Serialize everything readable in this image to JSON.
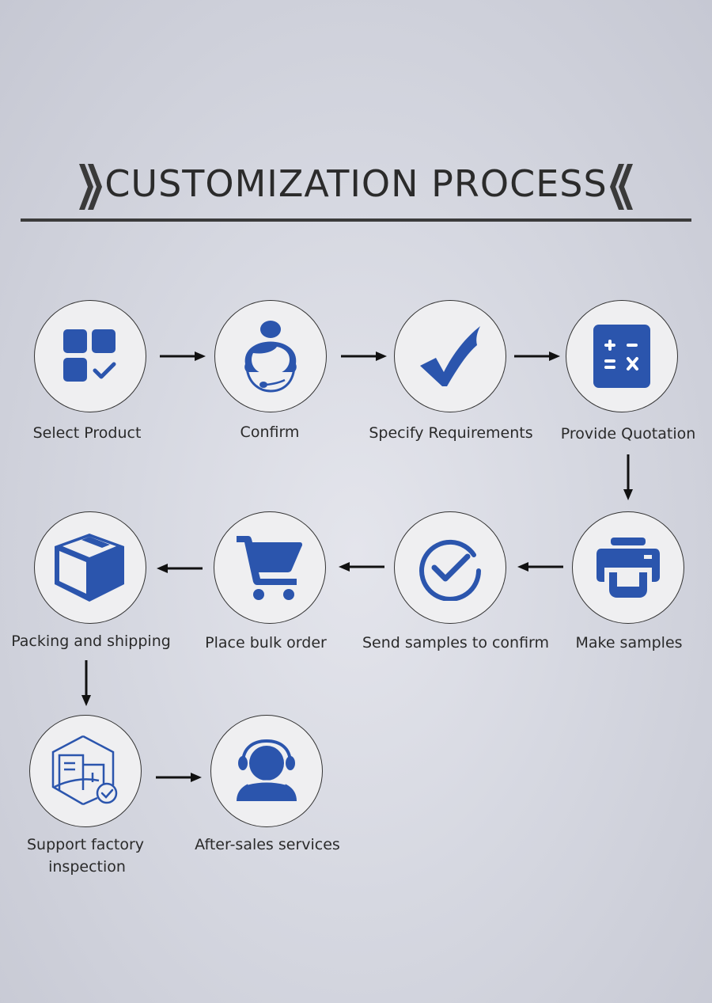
{
  "header": {
    "title": "CUSTOMIZATION PROCESS",
    "left_decoration": "double-chevron-right-icon",
    "right_decoration": "double-chevron-left-icon"
  },
  "colors": {
    "icon_blue": "#2b55ad",
    "text": "#2a2a2a",
    "arrow": "#111111",
    "circle_fill": "#efeff1"
  },
  "steps": [
    {
      "label": "Select Product",
      "icon": "grid-check-icon"
    },
    {
      "label": "Confirm",
      "icon": "headset-agent-icon"
    },
    {
      "label": "Specify Requirements",
      "icon": "checkmark-icon"
    },
    {
      "label": "Provide Quotation",
      "icon": "calculator-icon"
    },
    {
      "label": "Make samples",
      "icon": "printer-icon"
    },
    {
      "label": "Send samples to confirm",
      "icon": "circle-check-icon"
    },
    {
      "label": "Place bulk order",
      "icon": "shopping-cart-icon"
    },
    {
      "label": "Packing and shipping",
      "icon": "box-icon"
    },
    {
      "label": "Support factory inspection",
      "label_line1": "Support factory",
      "label_line2": "inspection",
      "icon": "factory-inspection-icon"
    },
    {
      "label": "After-sales services",
      "icon": "customer-service-icon"
    }
  ],
  "connections": [
    {
      "from": 0,
      "to": 1,
      "direction": "right"
    },
    {
      "from": 1,
      "to": 2,
      "direction": "right"
    },
    {
      "from": 2,
      "to": 3,
      "direction": "right"
    },
    {
      "from": 3,
      "to": 4,
      "direction": "down"
    },
    {
      "from": 4,
      "to": 5,
      "direction": "left"
    },
    {
      "from": 5,
      "to": 6,
      "direction": "left"
    },
    {
      "from": 6,
      "to": 7,
      "direction": "left"
    },
    {
      "from": 7,
      "to": 8,
      "direction": "down"
    },
    {
      "from": 8,
      "to": 9,
      "direction": "right"
    }
  ]
}
